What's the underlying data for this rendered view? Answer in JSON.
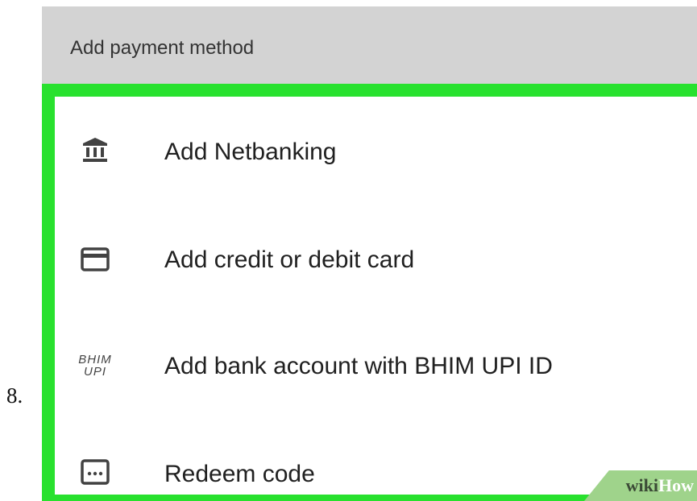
{
  "step_number": "8.",
  "header": {
    "title": "Add payment method"
  },
  "menu": {
    "items": [
      {
        "label": "Add Netbanking",
        "icon": "bank-icon"
      },
      {
        "label": "Add credit or debit card",
        "icon": "credit-card-icon"
      },
      {
        "label": "Add bank account with BHIM UPI ID",
        "icon": "bhim-upi-logo-icon",
        "icon_text": [
          "BHIM",
          "UPI"
        ]
      },
      {
        "label": "Redeem code",
        "icon": "redeem-code-icon"
      }
    ]
  },
  "watermark": {
    "part1": "wiki",
    "part2": "How"
  },
  "colors": {
    "header_bg": "#d3d3d3",
    "highlight_border": "#28e12e",
    "icon": "#424242",
    "watermark_bg": "#9fd38b"
  }
}
